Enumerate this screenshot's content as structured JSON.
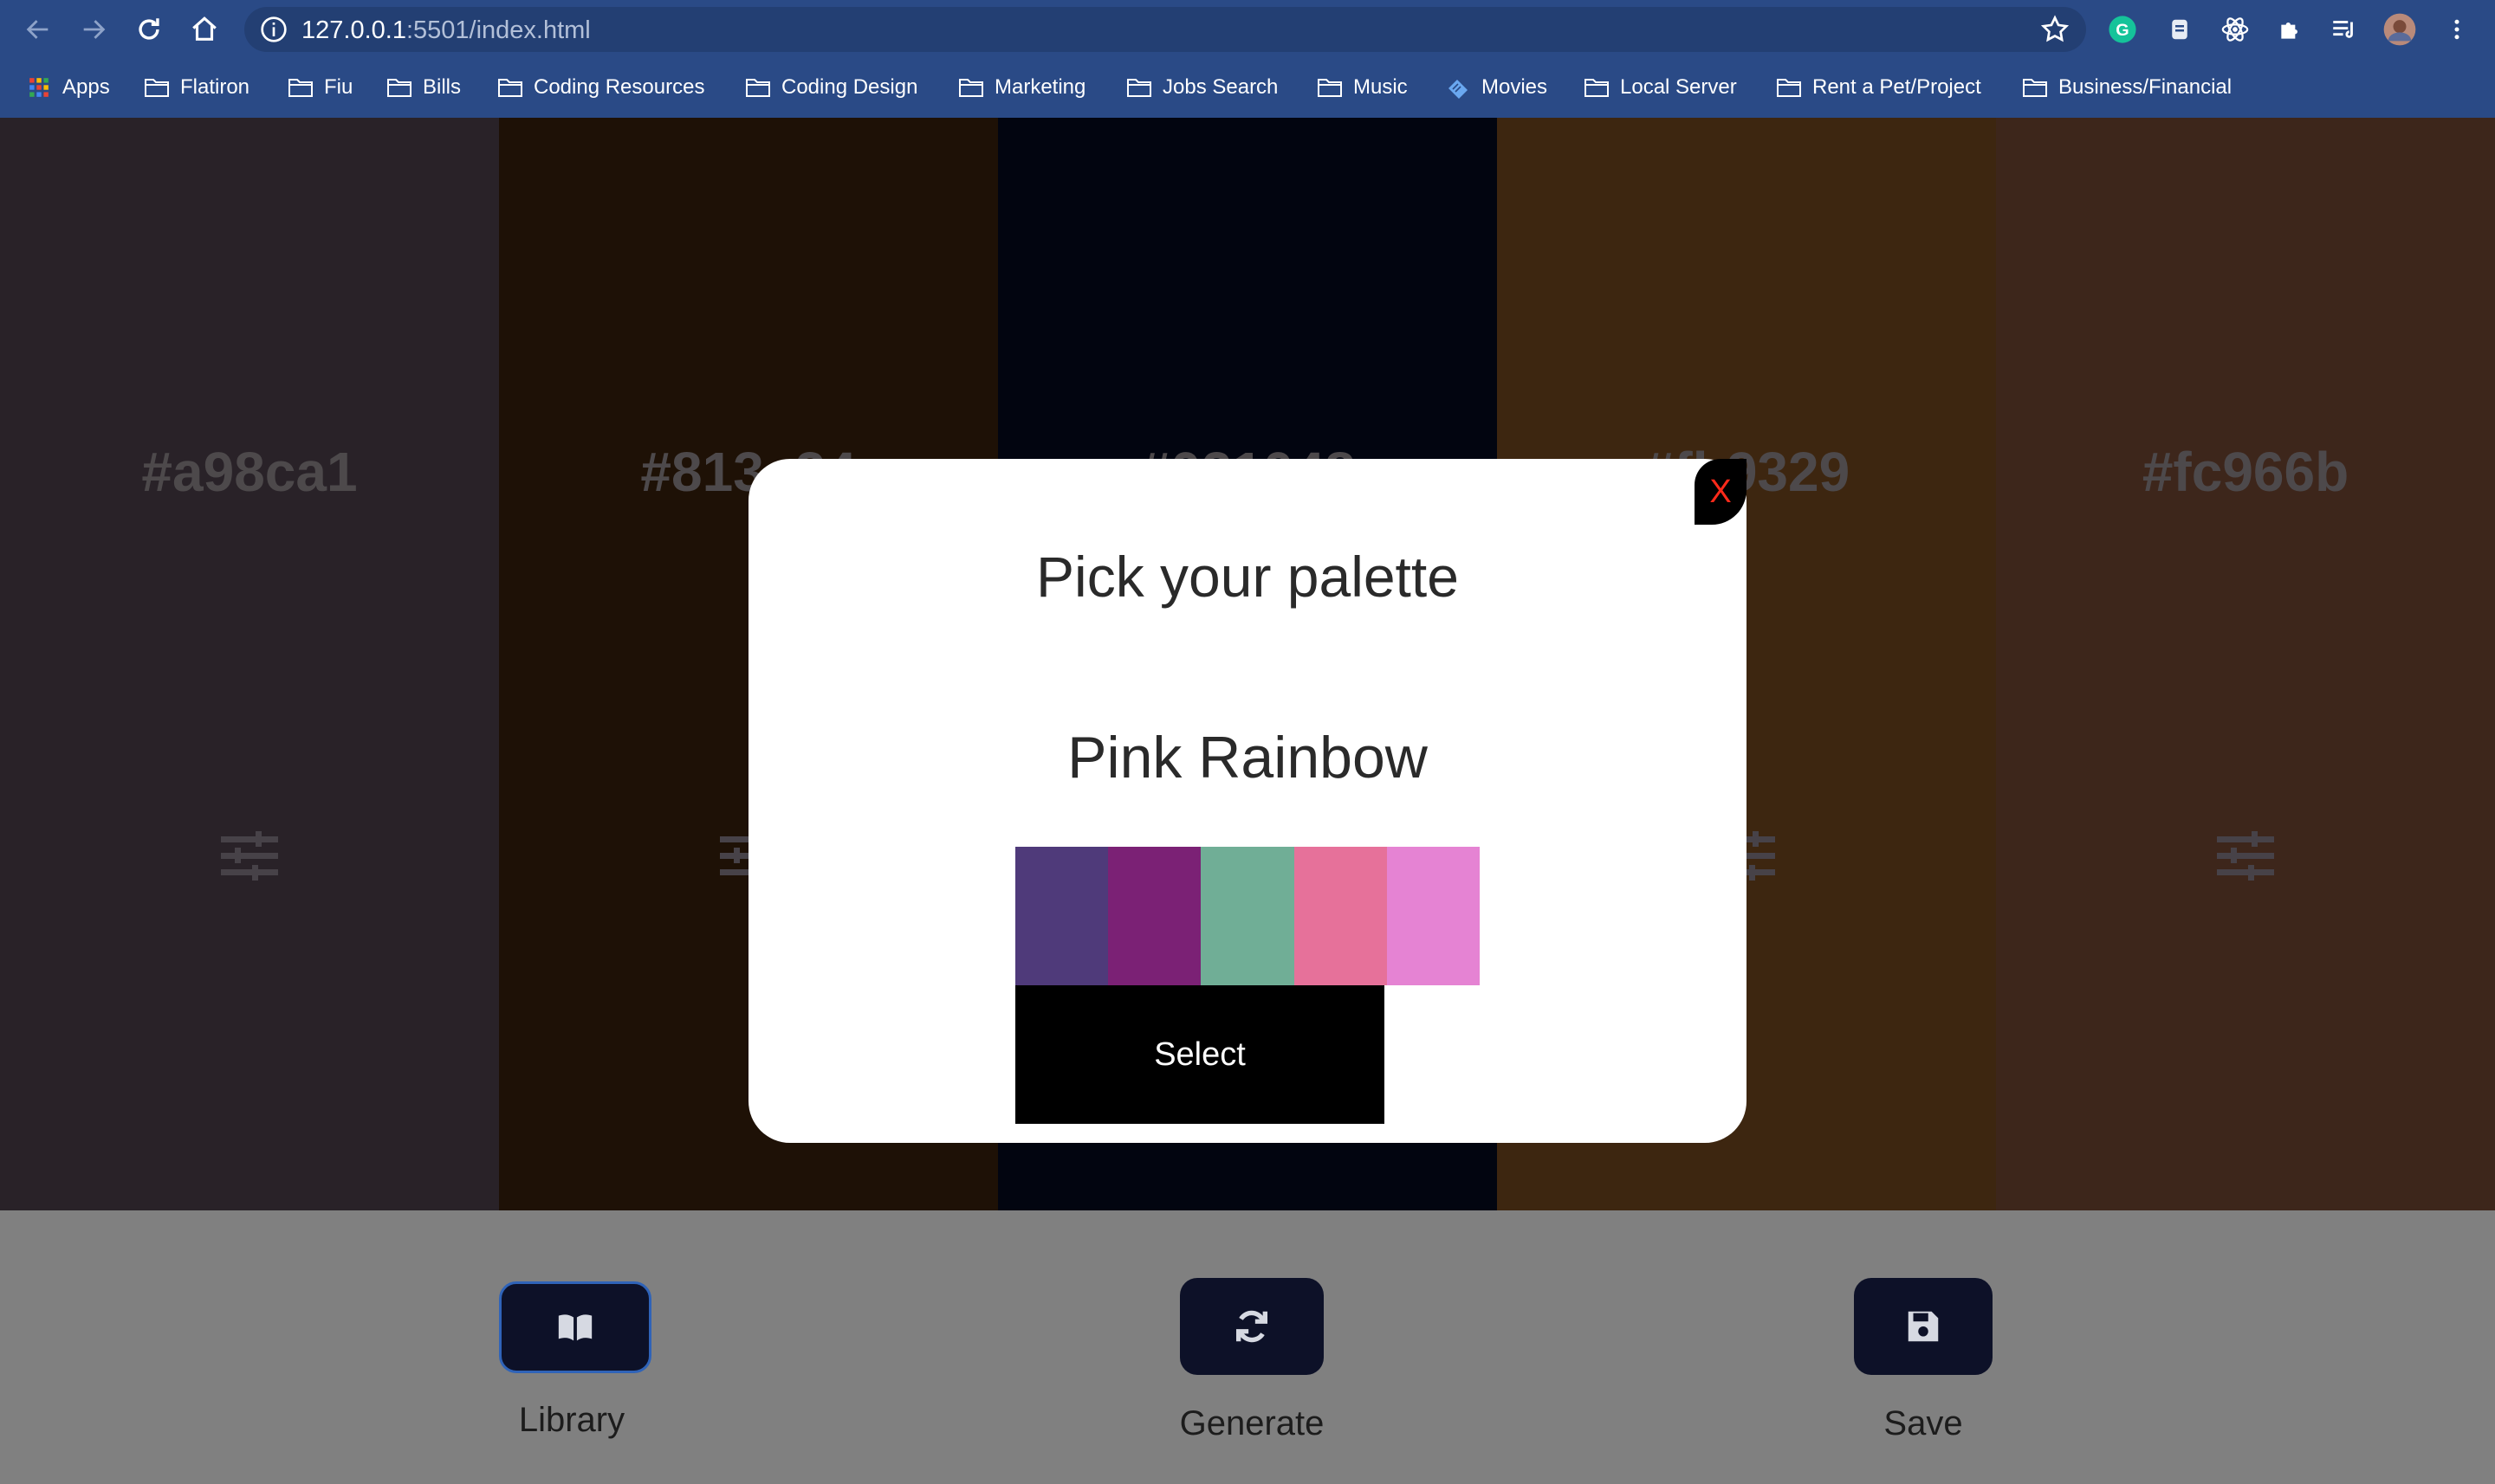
{
  "browser": {
    "url_host": "127.0.0.1",
    "url_rest": ":5501/index.html",
    "bookmarks": [
      {
        "label": "Apps",
        "icon": "apps-grid-icon"
      },
      {
        "label": "Flatiron",
        "icon": "folder-icon"
      },
      {
        "label": "Fiu",
        "icon": "folder-icon"
      },
      {
        "label": "Bills",
        "icon": "folder-icon"
      },
      {
        "label": "Coding Resources",
        "icon": "folder-icon"
      },
      {
        "label": "Coding Design",
        "icon": "folder-icon"
      },
      {
        "label": "Marketing",
        "icon": "folder-icon"
      },
      {
        "label": "Jobs Search",
        "icon": "folder-icon"
      },
      {
        "label": "Music",
        "icon": "folder-icon"
      },
      {
        "label": "Movies",
        "icon": "ticket-icon"
      },
      {
        "label": "Local Server",
        "icon": "folder-icon"
      },
      {
        "label": "Rent a Pet/Project",
        "icon": "folder-icon"
      },
      {
        "label": "Business/Financial",
        "icon": "folder-icon"
      }
    ]
  },
  "palette": {
    "columns": [
      {
        "hex": "#a98ca1",
        "background": "#524550"
      },
      {
        "hex": "#813_24",
        "background": "#3d230c"
      },
      {
        "hex": "#021048",
        "background": "#050a20"
      },
      {
        "hex": "#fb9329",
        "background": "#7a4c21"
      },
      {
        "hex": "#fc966b",
        "background": "#7a4c37"
      }
    ]
  },
  "modal": {
    "title": "Pick your palette",
    "palette_name": "Pink Rainbow",
    "swatches": [
      "#4f3a7a",
      "#7b2175",
      "#70ae96",
      "#e6719a",
      "#e583d3"
    ],
    "select_label": "Select",
    "close_label": "X"
  },
  "panel": {
    "library_label": "Library",
    "generate_label": "Generate",
    "save_label": "Save"
  }
}
